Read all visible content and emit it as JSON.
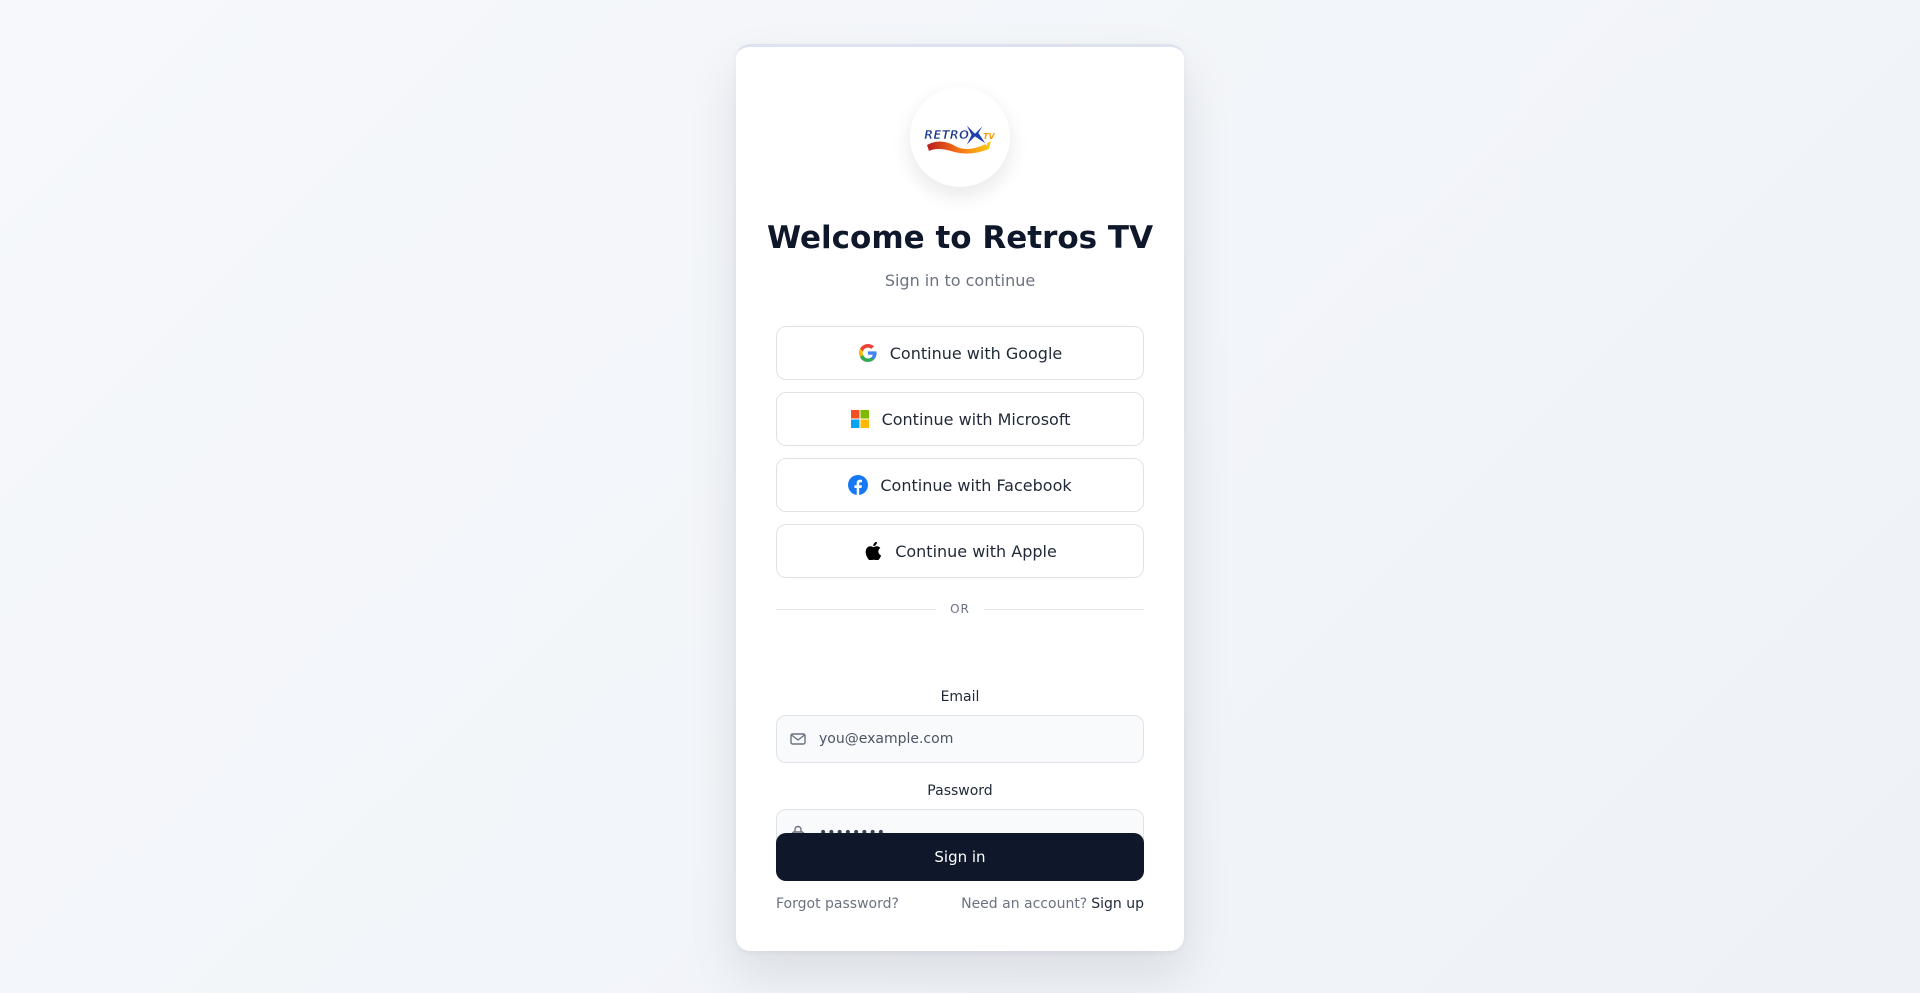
{
  "app": {
    "logo_alt": "Retros TV logo",
    "title": "Welcome to Retros TV",
    "subtitle": "Sign in to continue"
  },
  "social": [
    {
      "label": "Continue with Google",
      "icon": "google-icon"
    },
    {
      "label": "Continue with Microsoft",
      "icon": "microsoft-icon"
    },
    {
      "label": "Continue with Facebook",
      "icon": "facebook-icon"
    },
    {
      "label": "Continue with Apple",
      "icon": "apple-icon"
    }
  ],
  "divider_text": "OR",
  "form": {
    "email_label": "Email",
    "email_placeholder": "you@example.com",
    "email_value": "",
    "password_label": "Password",
    "password_value": "password",
    "submit_label": "Sign in"
  },
  "footer": {
    "forgot_label": "Forgot password?",
    "need_account": "Need an account?",
    "signup_label": "Sign up"
  },
  "colors": {
    "primary": "#0f172a",
    "background": "#f3f6fa",
    "muted_text": "#6b7280"
  }
}
